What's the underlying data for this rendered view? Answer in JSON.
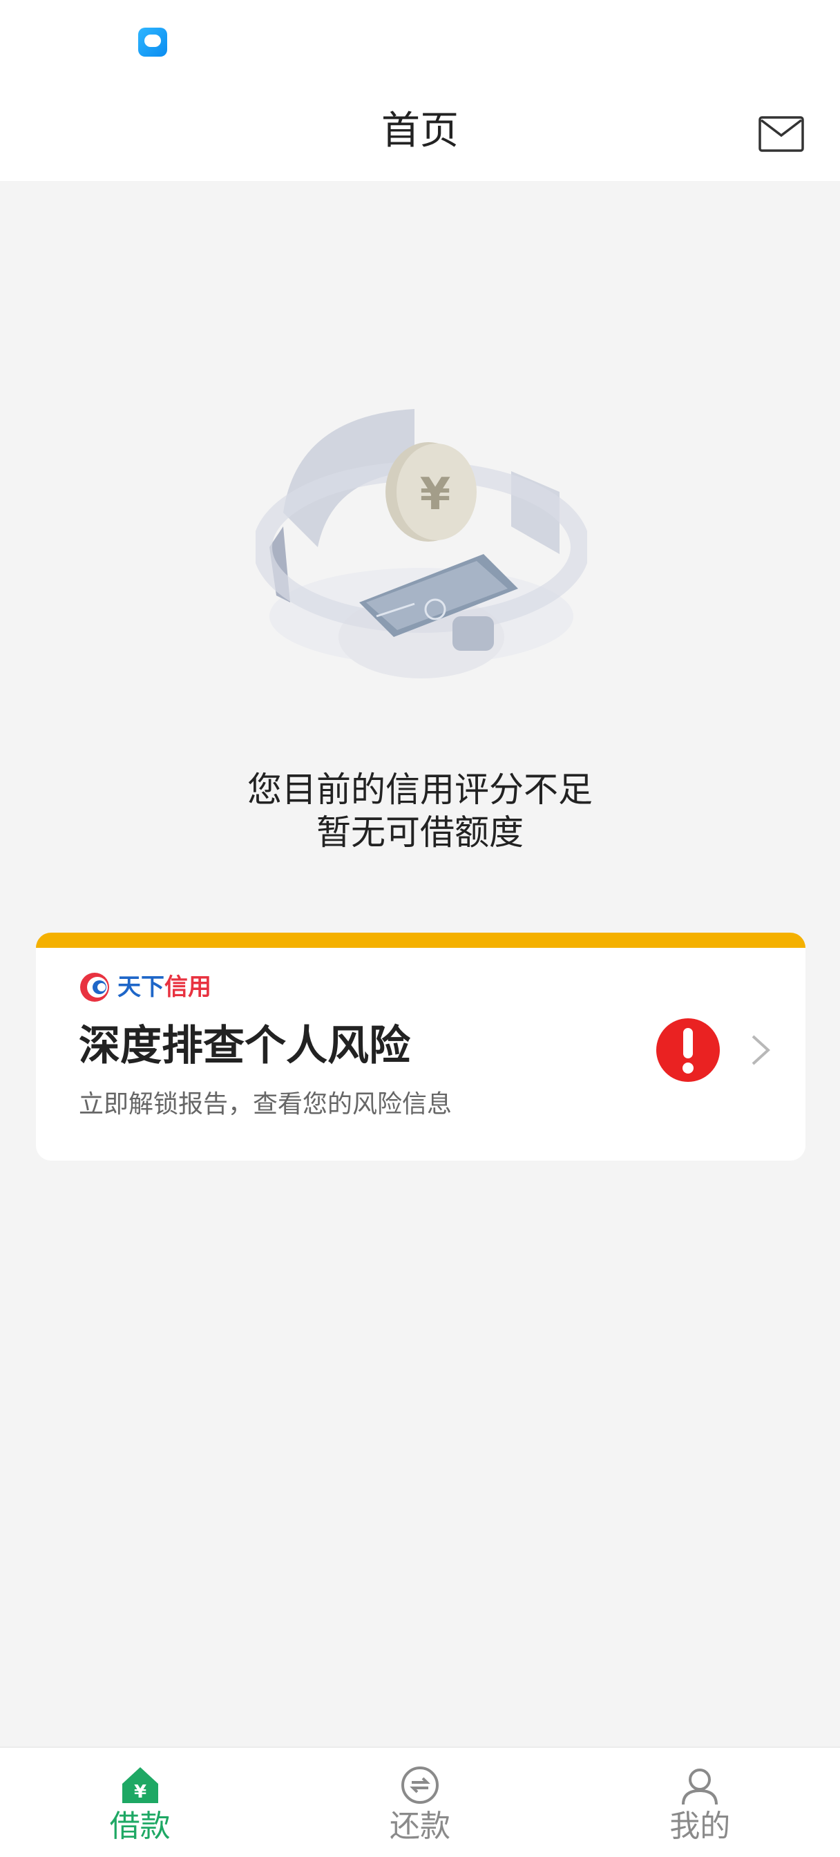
{
  "status_bar": {
    "notification_icon": "chat-bubble-icon"
  },
  "header": {
    "title": "首页",
    "mail_icon": "mail-icon"
  },
  "main": {
    "illustration_icon": "yuan-coin-illustration",
    "credit_message_line1": "您目前的信用评分不足",
    "credit_message_line2": "暂无可借额度"
  },
  "risk_card": {
    "brand_name_part1": "天下",
    "brand_name_part2": "信用",
    "title": "深度排查个人风险",
    "subtitle": "立即解锁报告，查看您的风险信息",
    "alert_icon": "exclamation-icon",
    "accent_color": "#f4b000",
    "alert_color": "#ea2222"
  },
  "tab_bar": {
    "tabs": [
      {
        "label": "借款",
        "icon": "home-yuan-icon",
        "active": true
      },
      {
        "label": "还款",
        "icon": "repay-icon",
        "active": false
      },
      {
        "label": "我的",
        "icon": "user-icon",
        "active": false
      }
    ],
    "active_color": "#1ea864",
    "inactive_color": "#8a8a8a"
  }
}
